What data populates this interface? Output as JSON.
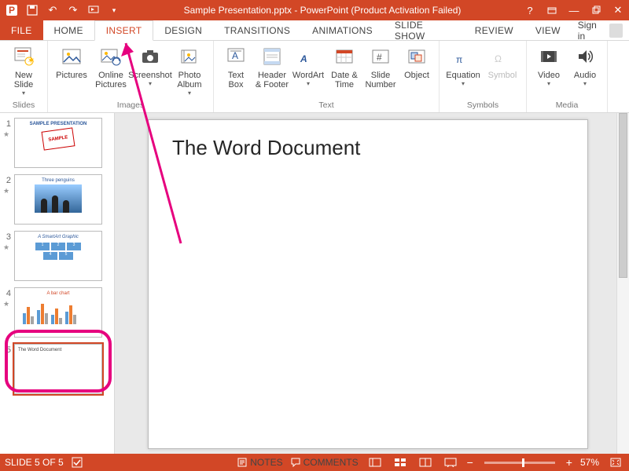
{
  "title": "Sample Presentation.pptx -  PowerPoint (Product Activation Failed)",
  "signin_label": "Sign in",
  "tabs": {
    "file": "FILE",
    "home": "HOME",
    "insert": "INSERT",
    "design": "DESIGN",
    "transitions": "TRANSITIONS",
    "animations": "ANIMATIONS",
    "slideshow": "SLIDE SHOW",
    "review": "REVIEW",
    "view": "VIEW"
  },
  "ribbon": {
    "slides": {
      "new_slide": "New\nSlide",
      "group": "Slides"
    },
    "images": {
      "pictures": "Pictures",
      "online_pictures": "Online\nPictures",
      "screenshot": "Screenshot",
      "photo_album": "Photo\nAlbum",
      "group": "Images"
    },
    "text": {
      "text_box": "Text\nBox",
      "header_footer": "Header\n& Footer",
      "wordart": "WordArt",
      "date_time": "Date &\nTime",
      "slide_number": "Slide\nNumber",
      "object": "Object",
      "group": "Text"
    },
    "symbols": {
      "equation": "Equation",
      "symbol": "Symbol",
      "group": "Symbols"
    },
    "media": {
      "video": "Video",
      "audio": "Audio",
      "group": "Media"
    }
  },
  "thumbs": [
    {
      "n": "1",
      "title": "SAMPLE PRESENTATION",
      "kind": "title"
    },
    {
      "n": "2",
      "title": "Three penguins",
      "kind": "pic"
    },
    {
      "n": "3",
      "title": "A SmartArt Graphic",
      "kind": "smartart"
    },
    {
      "n": "4",
      "title": "A bar chart",
      "kind": "chart"
    },
    {
      "n": "5",
      "title": "The Word Document",
      "kind": "text"
    }
  ],
  "current_slide_heading": "The Word Document",
  "status": {
    "slide_of": "SLIDE 5 OF 5",
    "notes": "NOTES",
    "comments": "COMMENTS",
    "zoom": "57%"
  }
}
